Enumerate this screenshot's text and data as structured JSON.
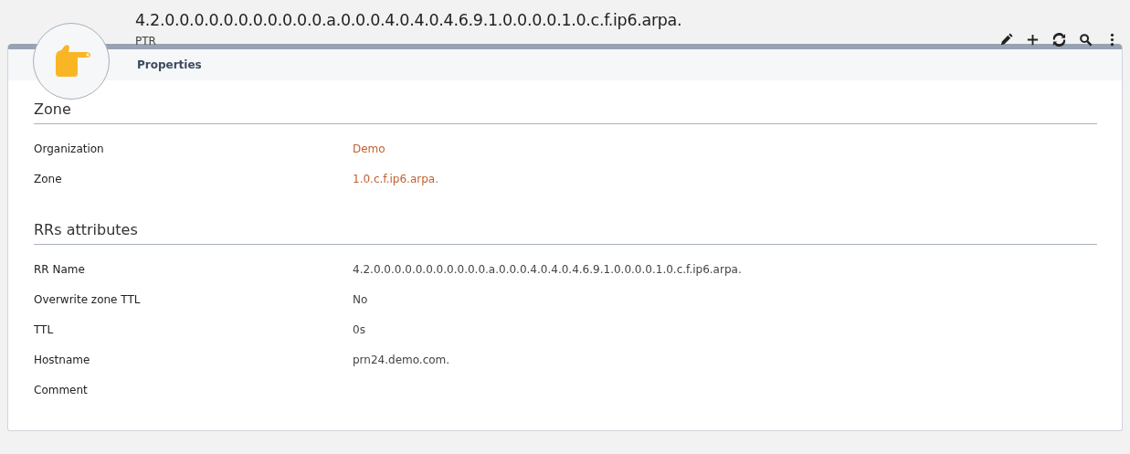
{
  "header": {
    "title": "4.2.0.0.0.0.0.0.0.0.0.0.0.a.0.0.0.4.0.4.0.4.6.9.1.0.0.0.0.1.0.c.f.ip6.arpa.",
    "subtitle": "PTR"
  },
  "toolbar": [
    {
      "kind": "edit"
    },
    {
      "kind": "add"
    },
    {
      "kind": "refresh"
    },
    {
      "kind": "search"
    },
    {
      "kind": "more"
    }
  ],
  "tabs": [
    {
      "label": "Properties",
      "selected": true
    }
  ],
  "sections": [
    {
      "title": "Zone",
      "fields": [
        {
          "label": "Organization",
          "value": "Demo",
          "kind": "link"
        },
        {
          "label": "Zone",
          "value": "1.0.c.f.ip6.arpa.",
          "kind": "link"
        }
      ]
    },
    {
      "title": "RRs attributes",
      "fields": [
        {
          "label": "RR Name",
          "value": "4.2.0.0.0.0.0.0.0.0.0.0.0.a.0.0.0.4.0.4.0.4.6.9.1.0.0.0.0.1.0.c.f.ip6.arpa.",
          "kind": "text"
        },
        {
          "label": "Overwrite zone TTL",
          "value": "No",
          "kind": "text"
        },
        {
          "label": "TTL",
          "value": "0s",
          "kind": "text"
        },
        {
          "label": "Hostname",
          "value": "prn24.demo.com.",
          "kind": "text"
        },
        {
          "label": "Comment"
        }
      ]
    }
  ]
}
